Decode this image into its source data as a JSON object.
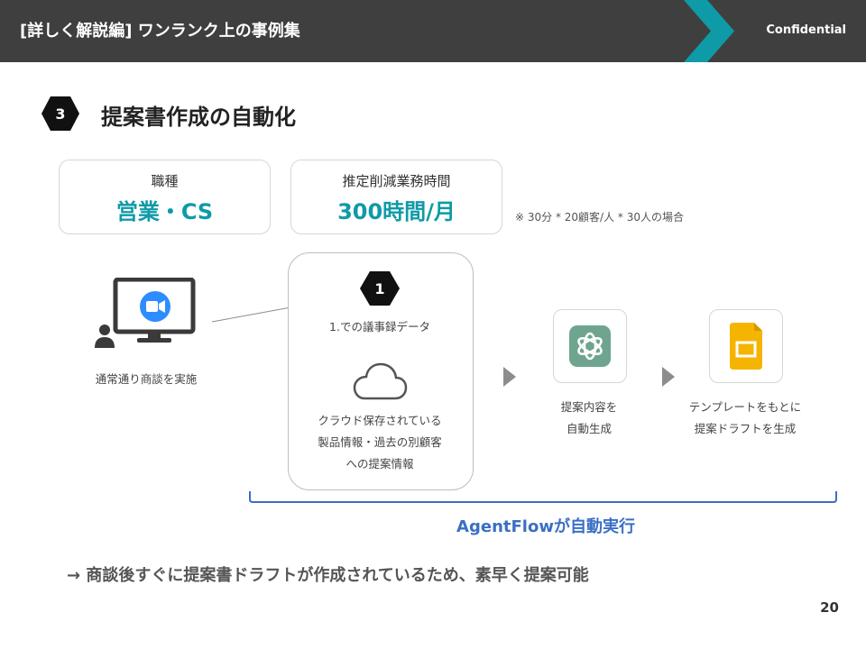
{
  "header": {
    "title": "[詳しく解説編] ワンランク上の事例集",
    "confidential": "Confidential",
    "accent_color": "#0e9aa7"
  },
  "section": {
    "number": "3",
    "title": "提案書作成の自動化"
  },
  "info_boxes": [
    {
      "label": "職種",
      "value": "営業・CS"
    },
    {
      "label": "推定削減業務時間",
      "value": "300時間/月"
    }
  ],
  "note": "※ 30分 * 20顧客/人 * 30人の場合",
  "flow": {
    "meeting_caption": "通常通り商談を実施",
    "step_badge": "1",
    "minutes_caption": "1.での議事録データ",
    "cloud_caption_lines": [
      "クラウド保存されている",
      "製品情報・過去の別顧客",
      "への提案情報"
    ],
    "generate_caption_lines": [
      "提案内容を",
      "自動生成"
    ],
    "template_caption_lines": [
      "テンプレートをもとに",
      "提案ドラフトを生成"
    ],
    "agentflow_label": "AgentFlowが自動実行"
  },
  "conclusion": "→ 商談後すぐに提案書ドラフトが作成されているため、素早く提案可能",
  "page_number": "20"
}
